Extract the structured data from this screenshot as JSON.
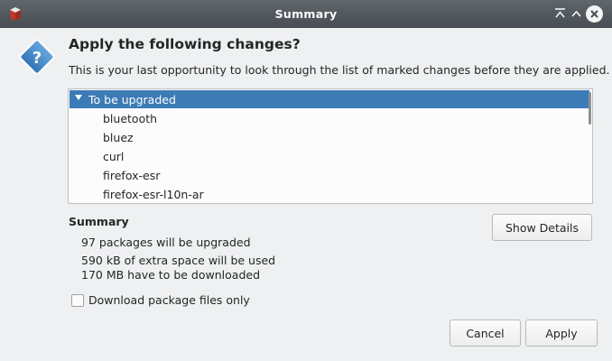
{
  "window": {
    "title": "Summary",
    "icons": {
      "app": "package-manager-icon",
      "keep_above": "keep-above-icon",
      "maximize": "maximize-icon",
      "close": "close-icon"
    }
  },
  "dialog": {
    "icon": "question-icon",
    "heading": "Apply the following changes?",
    "description": "This is your last opportunity to look through the list of marked changes before they are applied."
  },
  "changes": {
    "group_label": "To be upgraded",
    "expanded": true,
    "packages": [
      "bluetooth",
      "bluez",
      "curl",
      "firefox-esr",
      "firefox-esr-l10n-ar"
    ]
  },
  "summary": {
    "title": "Summary",
    "upgrade_count": "97 packages will be upgraded",
    "extra_space": "590 kB of extra space will be used",
    "download_size": "170 MB have to be downloaded"
  },
  "options": {
    "download_only_label": "Download package files only",
    "download_only_checked": false
  },
  "buttons": {
    "show_details": "Show Details",
    "cancel": "Cancel",
    "apply": "Apply"
  },
  "colors": {
    "titlebar": "#474d52",
    "selection": "#3d7bb6",
    "background": "#eff0f1"
  }
}
